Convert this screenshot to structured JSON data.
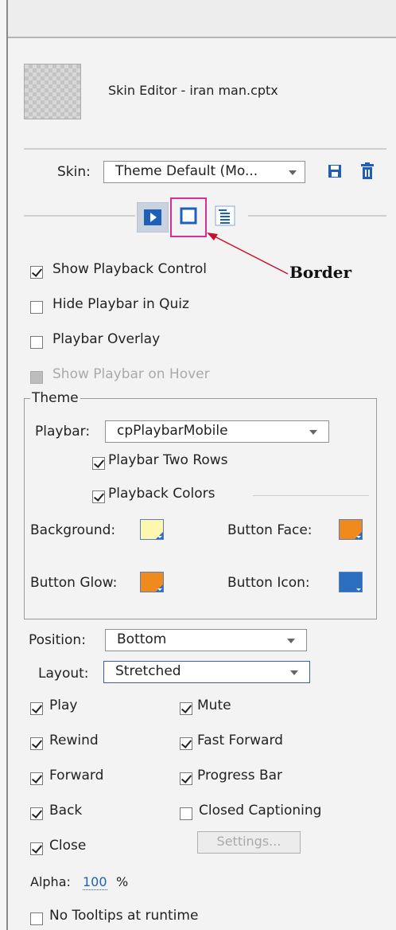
{
  "header": {
    "title": "Skin Editor - iran man.cptx"
  },
  "skin": {
    "label": "Skin:",
    "value": "Theme Default (Mo..."
  },
  "annotation": {
    "label": "Border"
  },
  "options": {
    "show_playback_control": "Show Playback Control",
    "hide_playbar_in_quiz": "Hide Playbar in Quiz",
    "playbar_overlay": "Playbar Overlay",
    "show_playbar_on_hover": "Show Playbar on Hover"
  },
  "theme": {
    "legend": "Theme",
    "playbar_label": "Playbar:",
    "playbar_value": "cpPlaybarMobile",
    "playbar_two_rows": "Playbar Two Rows",
    "playback_colors": "Playback Colors",
    "background_label": "Background:",
    "button_face_label": "Button Face:",
    "button_glow_label": "Button Glow:",
    "button_icon_label": "Button Icon:"
  },
  "position": {
    "label": "Position:",
    "value": "Bottom"
  },
  "layout": {
    "label": "Layout:",
    "value": "Stretched"
  },
  "controls": {
    "play": "Play",
    "mute": "Mute",
    "rewind": "Rewind",
    "fast_forward": "Fast Forward",
    "forward": "Forward",
    "progress_bar": "Progress Bar",
    "back": "Back",
    "closed_captioning": "Closed Captioning",
    "close": "Close",
    "settings_button": "Settings..."
  },
  "alpha": {
    "label": "Alpha:",
    "value": "100",
    "unit": "%"
  },
  "no_tooltips": "No Tooltips at runtime",
  "colors": {
    "background": "#fdf7b0",
    "button_face": "#f08a1c",
    "button_glow": "#f08a1c",
    "button_icon": "#2a6fc0",
    "annotation": "#c8102e",
    "highlight": "#d62f9a"
  }
}
